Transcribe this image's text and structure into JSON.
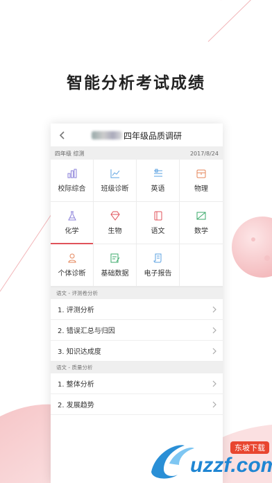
{
  "headline": "智能分析考试成绩",
  "header": {
    "title": "四年级品质调研"
  },
  "info": {
    "left": "四年级  综测",
    "date": "2017/8/24"
  },
  "grid": {
    "items": [
      {
        "label": "校际综合",
        "icon": "bar-chart-icon",
        "color": "#8a7fd8"
      },
      {
        "label": "班级诊断",
        "icon": "trend-chart-icon",
        "color": "#5aa0e0"
      },
      {
        "label": "英语",
        "icon": "alphabet-icon",
        "color": "#5aa0e0"
      },
      {
        "label": "物理",
        "icon": "box-icon",
        "color": "#e5855a"
      },
      {
        "label": "化学",
        "icon": "flask-icon",
        "color": "#8a7fd8"
      },
      {
        "label": "生物",
        "icon": "diamond-icon",
        "color": "#e0525a"
      },
      {
        "label": "语文",
        "icon": "book-icon",
        "color": "#e0525a"
      },
      {
        "label": "数学",
        "icon": "ruler-icon",
        "color": "#3aaa6a"
      },
      {
        "label": "个体诊断",
        "icon": "person-icon",
        "color": "#e5855a"
      },
      {
        "label": "基础数据",
        "icon": "data-edit-icon",
        "color": "#3aaa6a"
      },
      {
        "label": "电子报告",
        "icon": "scroll-icon",
        "color": "#5aa0e0"
      }
    ],
    "active": "化学"
  },
  "sections": [
    {
      "title": "语文 - 评测卷分析",
      "rows": [
        "1. 评测分析",
        "2. 错误汇总与归因",
        "3. 知识达成度"
      ]
    },
    {
      "title": "语文 - 质量分析",
      "rows": [
        "1. 整体分析",
        "2. 发展趋势"
      ]
    }
  ],
  "watermark": {
    "brand": "uzzf.com",
    "tag": "东坡下载"
  }
}
